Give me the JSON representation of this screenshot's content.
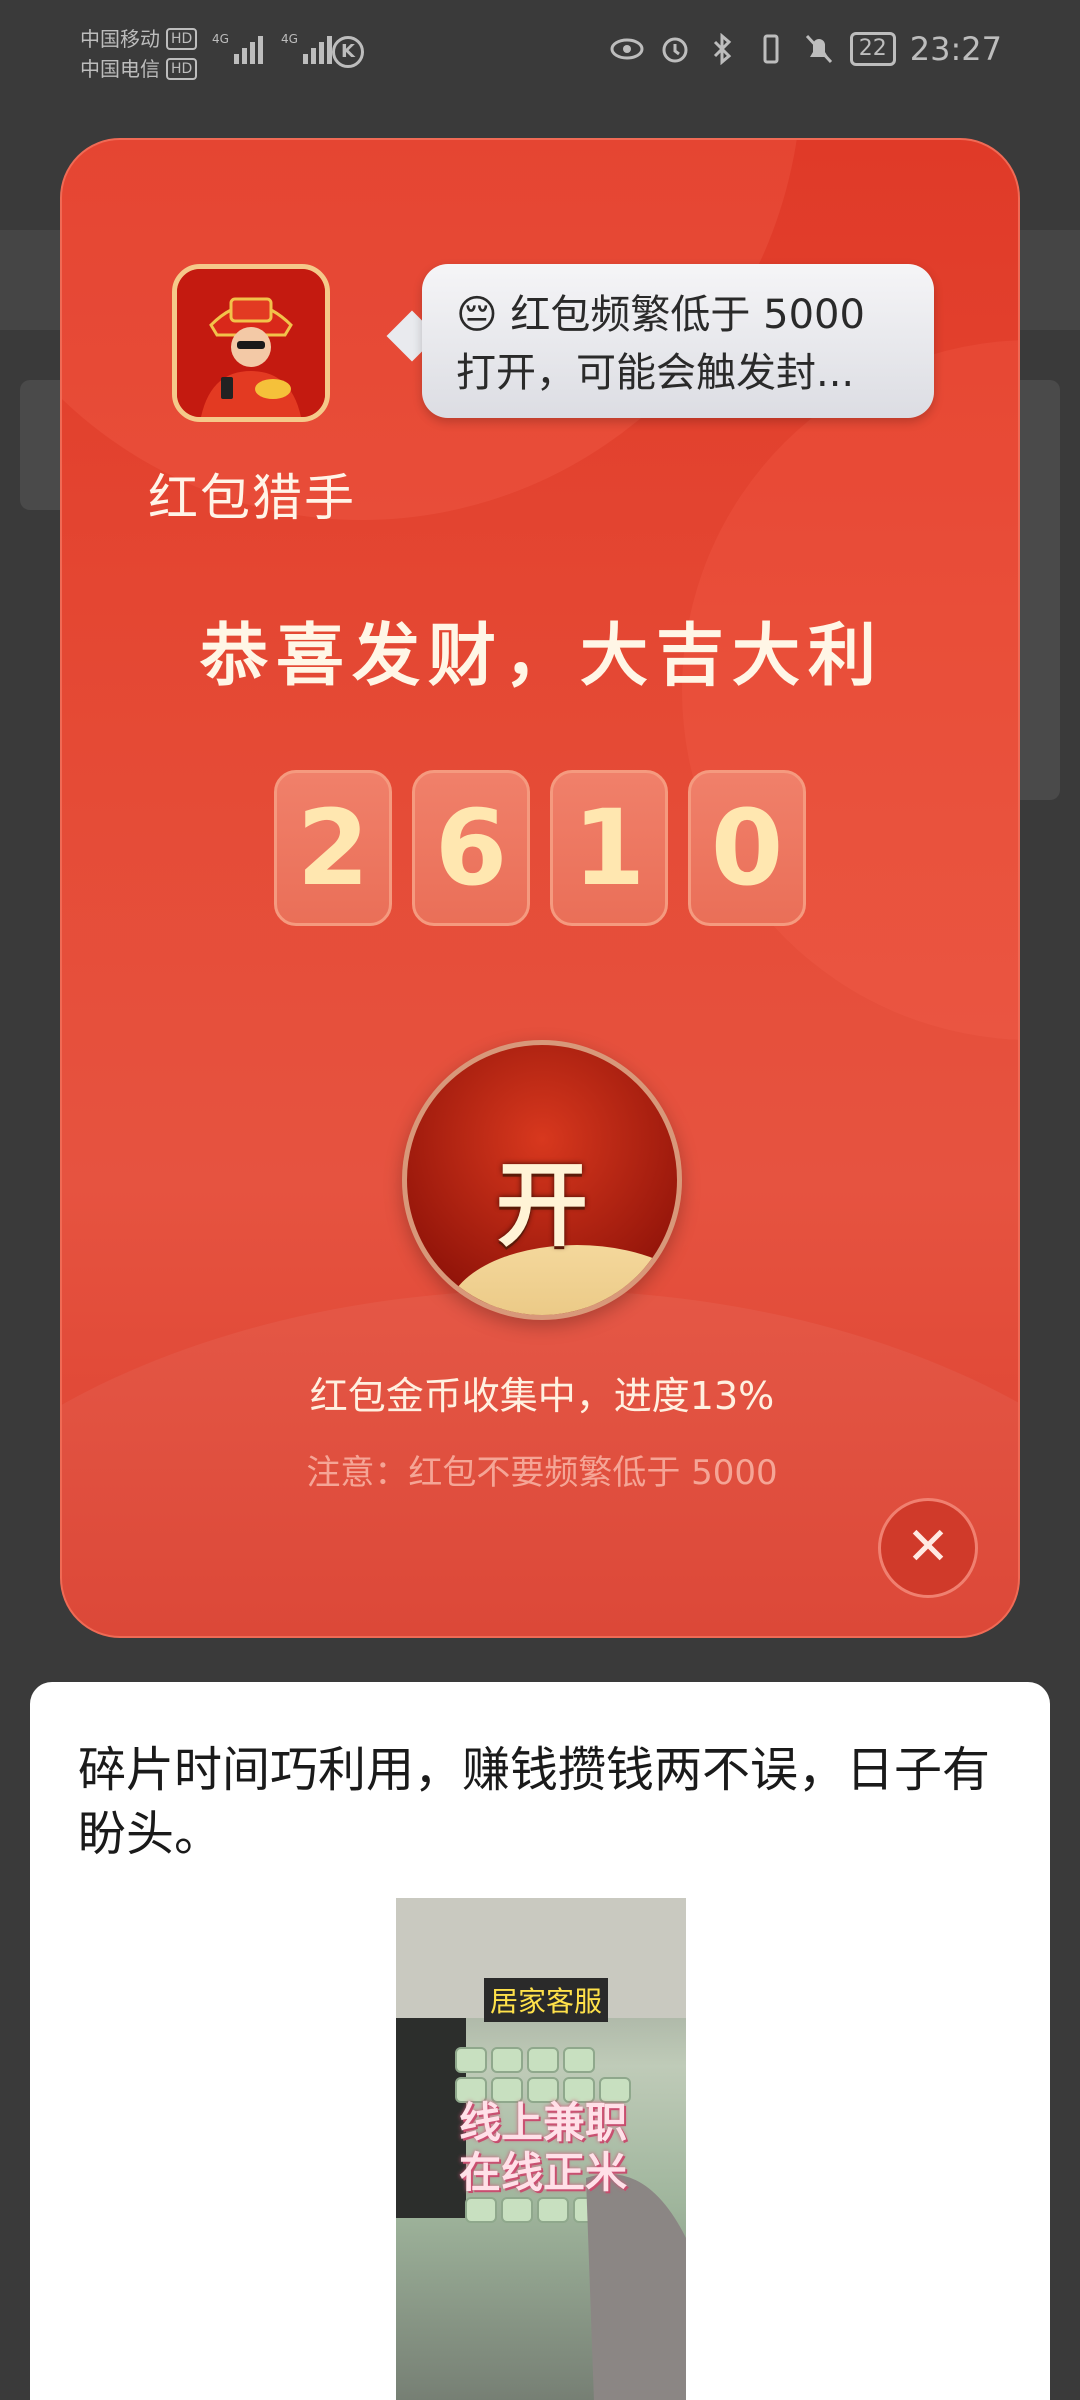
{
  "status_bar": {
    "carrier1": "中国移动",
    "carrier2": "中国电信",
    "hd": "HD",
    "net": "4G",
    "battery": "22",
    "time": "23:27"
  },
  "popup": {
    "app_name": "红包猎手",
    "bubble_emoji": "😔",
    "bubble_text": "红包频繁低于 5000 打开，可能会触发封...",
    "headline": "恭喜发财，大吉大利",
    "digits": [
      "2",
      "6",
      "1",
      "0"
    ],
    "open_label": "开",
    "progress_text": "红包金币收集中，进度13%",
    "progress_percent": 13,
    "notice_text": "注意：红包不要频繁低于 5000",
    "close_symbol": "✕"
  },
  "ad": {
    "text": "碎片时间巧利用，赚钱攒钱两不误，日子有盼头。",
    "image_tag": "居家客服",
    "image_caption": "线上兼职在线正米"
  }
}
